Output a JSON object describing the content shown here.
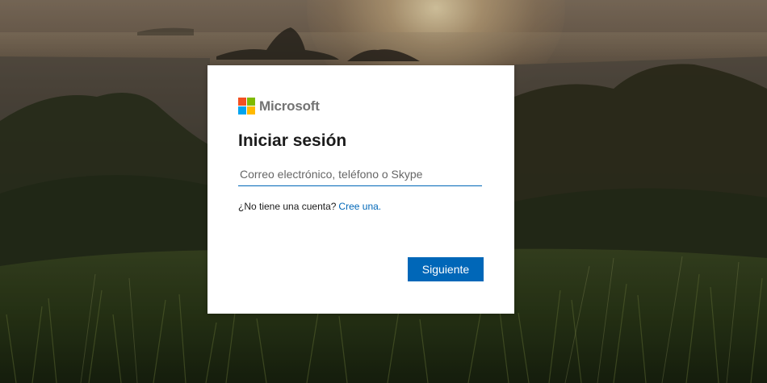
{
  "brand": {
    "name": "Microsoft",
    "logo_colors": [
      "#f25022",
      "#7fba00",
      "#00a4ef",
      "#ffb900"
    ]
  },
  "login": {
    "title": "Iniciar sesión",
    "email_placeholder": "Correo electrónico, teléfono o Skype",
    "email_value": "",
    "no_account_text": "¿No tiene una cuenta?",
    "create_link": "Cree una.",
    "next_button": "Siguiente"
  },
  "colors": {
    "accent": "#0067b8",
    "card_background": "#ffffff"
  }
}
